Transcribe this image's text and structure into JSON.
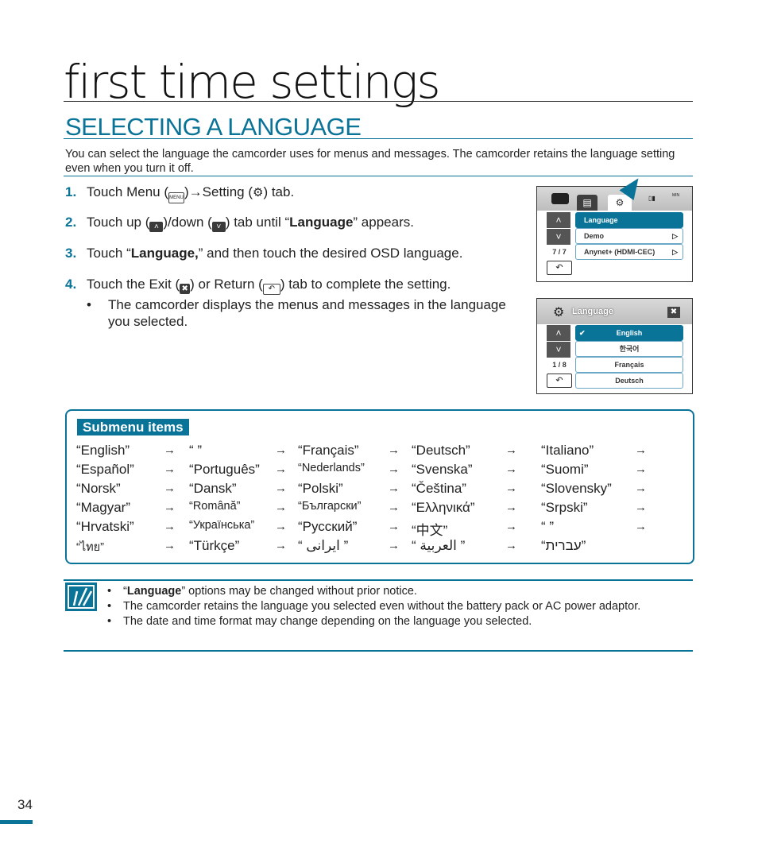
{
  "header": {
    "chapter_title": "first time settings",
    "section_title": "SELECTING A LANGUAGE",
    "intro": "You can select the language the camcorder uses for menus and messages. The camcorder retains the language setting even when you turn it off."
  },
  "steps": [
    {
      "num": "1.",
      "parts": [
        "Touch Menu (",
        ")",
        "Setting (",
        ") tab."
      ],
      "arrow": "→",
      "menu_icon": "MENU",
      "setting_icon": "⚙"
    },
    {
      "num": "2.",
      "pre": "Touch up (",
      "mid": ")/down (",
      "post": ") tab until “",
      "bold": "Language",
      "end": "” appears.",
      "up_icon": "˄",
      "down_icon": "˅"
    },
    {
      "num": "3.",
      "pre": "Touch “",
      "bold": "Language,",
      "end": "” and then touch the desired OSD language."
    },
    {
      "num": "4.",
      "pre": "Touch the Exit (",
      "mid": ") or Return (",
      "end": ") tab to complete the setting.",
      "exit_icon": "✖",
      "return_icon": "↶"
    }
  ],
  "step4_bullet": "The camcorder displays the menus and messages in the language you selected.",
  "bullet_glyph": "•",
  "screen1": {
    "tabs": [
      "camera-icon",
      "menu-icon",
      "settings-icon"
    ],
    "battery": "▯▮",
    "time_label": "MIN",
    "items": [
      {
        "label": "Language",
        "selected": true
      },
      {
        "label": "Demo",
        "value_icon": "▷"
      },
      {
        "label": "Anynet+ (HDMI-CEC)",
        "value_icon": "▷"
      }
    ],
    "page": "7 / 7",
    "up": "˄",
    "down": "˅",
    "return": "↶"
  },
  "screen2": {
    "title": "Language",
    "close": "✖",
    "gear": "⚙",
    "items": [
      {
        "label": "English",
        "selected": true,
        "check": "✔"
      },
      {
        "label": "한국어"
      },
      {
        "label": "Français"
      },
      {
        "label": "Deutsch"
      }
    ],
    "page": "1 / 8",
    "up": "˄",
    "down": "˅",
    "return": "↶"
  },
  "submenu": {
    "label": "Submenu items",
    "arrow": "→",
    "rows": [
      [
        "“English”",
        "“            ”",
        "“Français”",
        "“Deutsch”",
        "“Italiano”"
      ],
      [
        "“Español”",
        "“Português”",
        "“Nederlands”",
        "“Svenska”",
        "“Suomi”"
      ],
      [
        "“Norsk”",
        "“Dansk”",
        "“Polski”",
        "“Čeština”",
        "“Slovensky”"
      ],
      [
        "“Magyar”",
        "“Română”",
        "“Български”",
        "“Ελληνικά”",
        "“Srpski”"
      ],
      [
        "“Hrvatski”",
        "“Українська”",
        "“Русский”",
        "“中文”",
        "“            ”"
      ],
      [
        "“ไทย”",
        "“Türkçe”",
        "“ ایرانی ”",
        "“ العربية ”",
        "“עברית”"
      ]
    ]
  },
  "notes": [
    {
      "pre": "“",
      "bold": "Language",
      "end": "” options may be changed without prior notice."
    },
    {
      "text": "The camcorder retains the language you selected even without the battery pack or AC power adaptor."
    },
    {
      "text": "The date and time format may change depending on the language you selected."
    }
  ],
  "footer": {
    "page_number": "34"
  },
  "colors": {
    "accent": "#0a7398",
    "text": "#222222"
  }
}
